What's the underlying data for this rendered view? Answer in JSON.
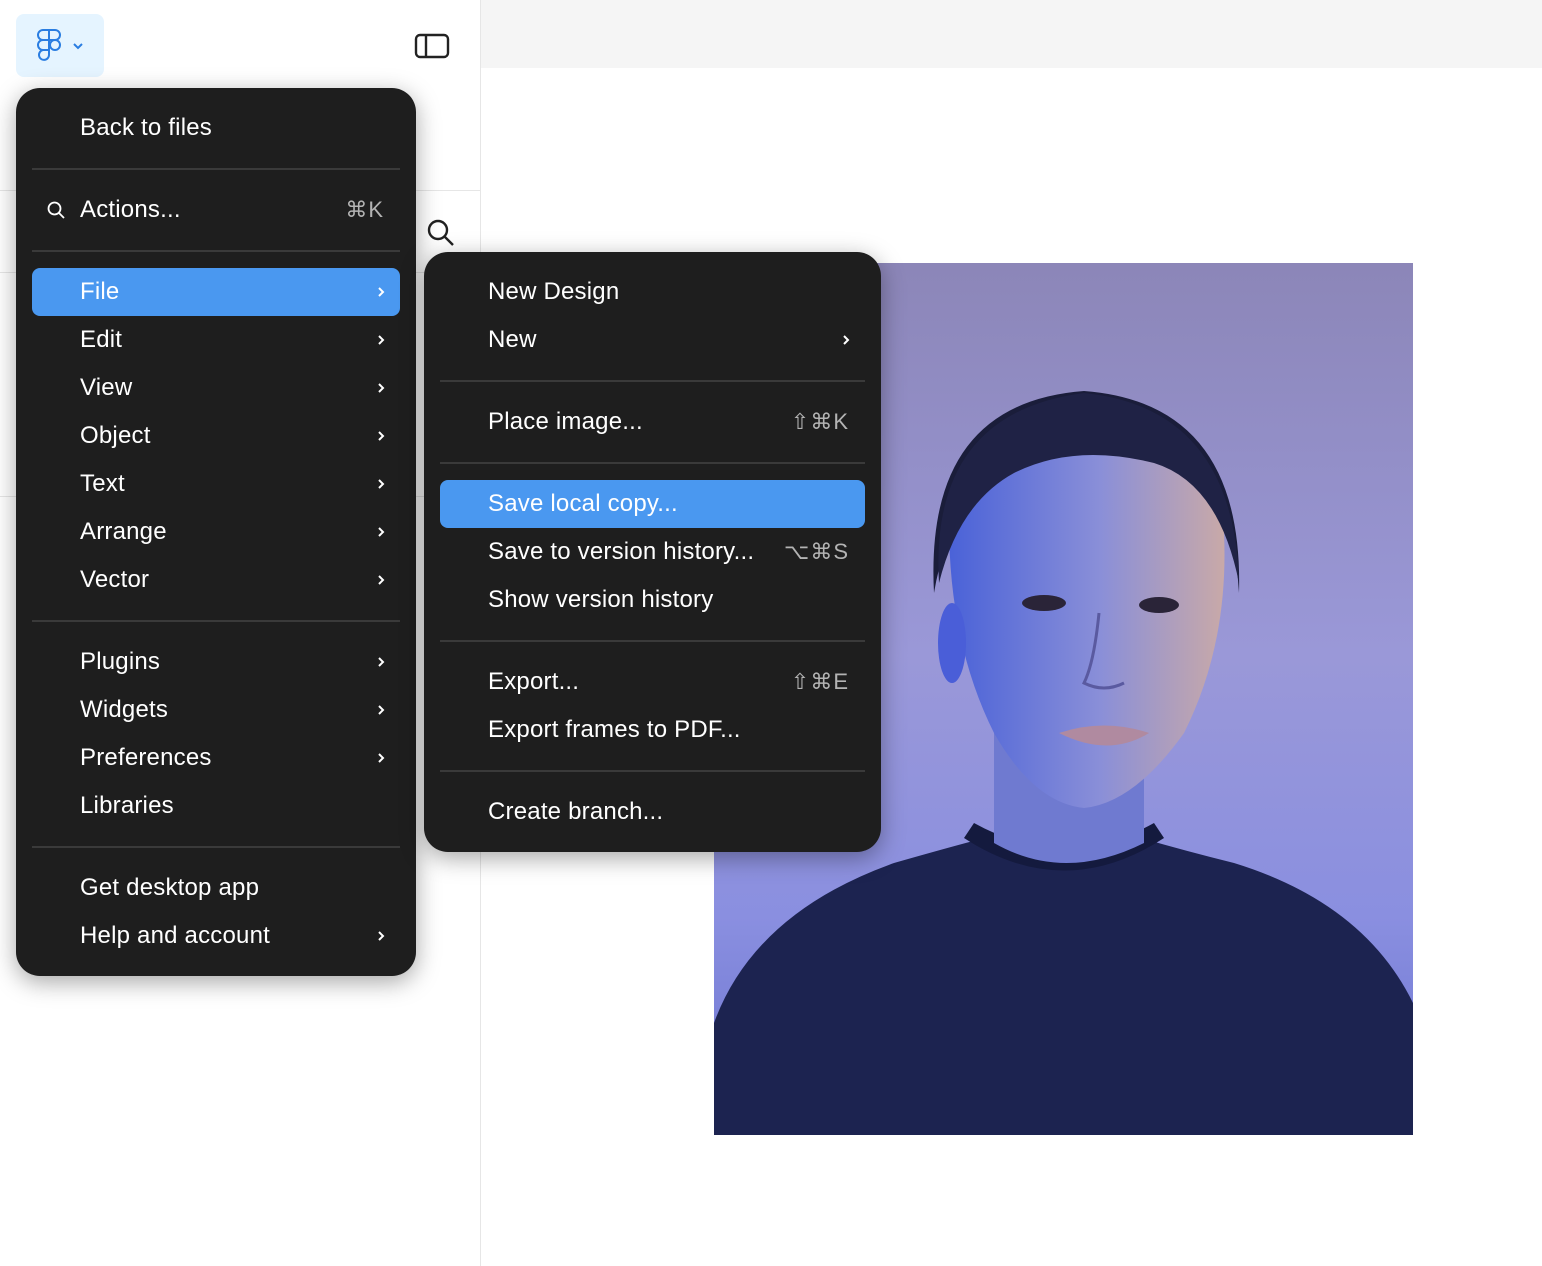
{
  "main_menu": {
    "back_to_files": "Back to files",
    "actions": {
      "label": "Actions...",
      "shortcut": "⌘K"
    },
    "items": [
      {
        "label": "File"
      },
      {
        "label": "Edit"
      },
      {
        "label": "View"
      },
      {
        "label": "Object"
      },
      {
        "label": "Text"
      },
      {
        "label": "Arrange"
      },
      {
        "label": "Vector"
      },
      {
        "label": "Plugins"
      },
      {
        "label": "Widgets"
      },
      {
        "label": "Preferences"
      },
      {
        "label": "Libraries"
      },
      {
        "label": "Get desktop app"
      },
      {
        "label": "Help and account"
      }
    ]
  },
  "file_submenu": {
    "items": [
      {
        "label": "New Design"
      },
      {
        "label": "New"
      },
      {
        "label": "Place image...",
        "shortcut": "⇧⌘K"
      },
      {
        "label": "Save local copy..."
      },
      {
        "label": "Save to version history...",
        "shortcut": "⌥⌘S"
      },
      {
        "label": "Show version history"
      },
      {
        "label": "Export...",
        "shortcut": "⇧⌘E"
      },
      {
        "label": "Export frames to PDF..."
      },
      {
        "label": "Create branch..."
      }
    ]
  },
  "colors": {
    "menu_bg": "#1e1e1e",
    "highlight": "#4a98f0",
    "logo_bg": "#e5f4ff"
  }
}
